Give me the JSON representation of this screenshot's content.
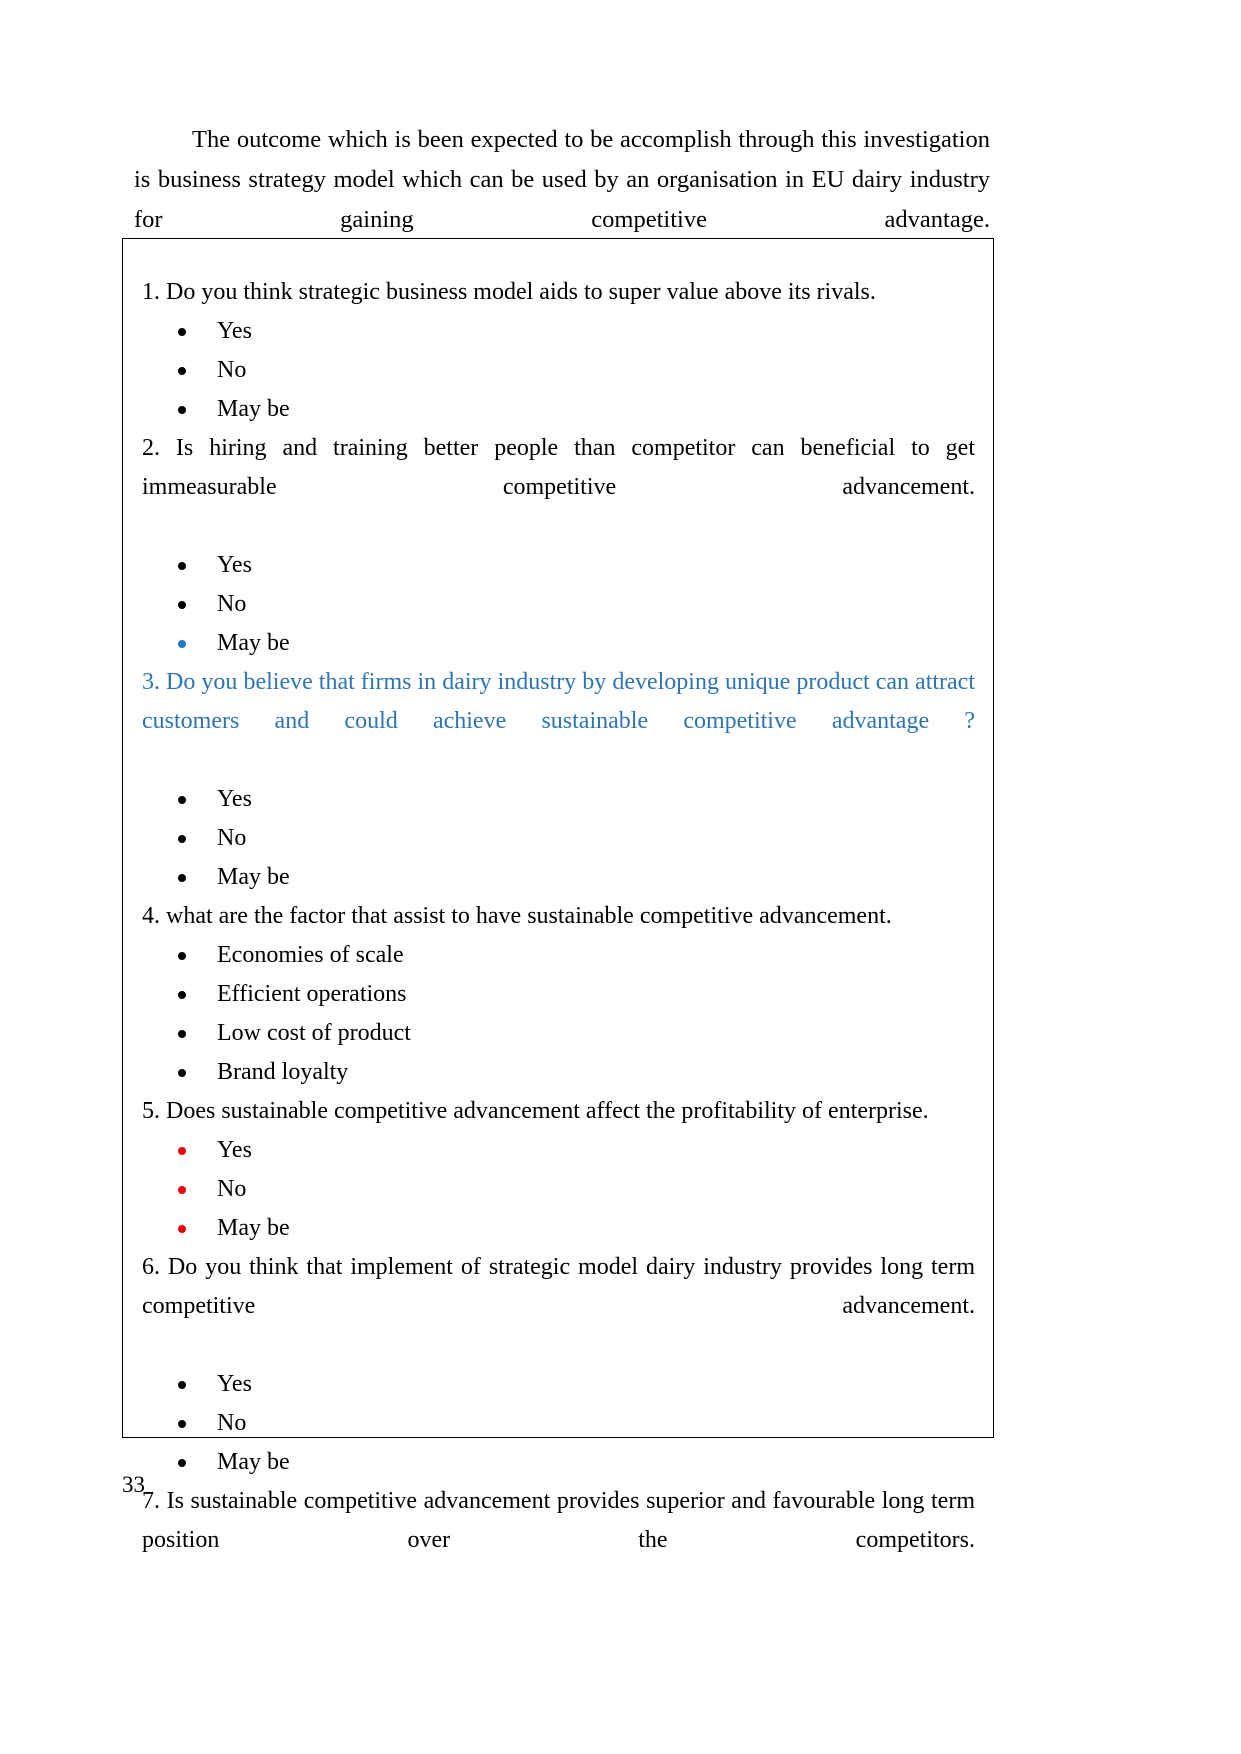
{
  "document": {
    "intro_paragraph": "The  outcome which is been expected  to be accomplish through this investigation is business strategy model which can be used by an organisation in EU dairy industry for gaining competitive advantage.",
    "page_number": "33"
  },
  "colors": {
    "text": "#000000",
    "blue_accent": "#2E74B5",
    "blue_bullet": "#1F7AC4",
    "red_bullet": "#E8000B",
    "border": "#000000"
  },
  "questionnaire": {
    "questions": [
      {
        "text": "1. Do you think strategic business model aids to super value above its rivals.",
        "color": "black",
        "justify": false,
        "options": [
          {
            "label": "Yes",
            "bullet_color": "black"
          },
          {
            "label": "No",
            "bullet_color": "black"
          },
          {
            "label": "May be",
            "bullet_color": "black"
          }
        ]
      },
      {
        "text": "2. Is hiring and training better people than competitor can beneficial to get immeasurable competitive advancement.",
        "color": "black",
        "justify": true,
        "options": [
          {
            "label": "Yes",
            "bullet_color": "black"
          },
          {
            "label": "No",
            "bullet_color": "black"
          },
          {
            "label": "May be",
            "bullet_color": "blue"
          }
        ]
      },
      {
        "text": "3. Do you believe that firms in dairy industry by developing unique product can attract customers  and could achieve sustainable competitive advantage ?",
        "color": "blue",
        "justify": true,
        "options": [
          {
            "label": "Yes",
            "bullet_color": "black"
          },
          {
            "label": "No",
            "bullet_color": "black"
          },
          {
            "label": "May be",
            "bullet_color": "black"
          }
        ]
      },
      {
        "text": "4. what are the factor that assist to have sustainable competitive advancement.",
        "color": "black",
        "justify": false,
        "options": [
          {
            "label": "Economies of scale",
            "bullet_color": "black"
          },
          {
            "label": "Efficient operations",
            "bullet_color": "black"
          },
          {
            "label": "Low cost of product",
            "bullet_color": "black"
          },
          {
            "label": "Brand loyalty",
            "bullet_color": "black"
          }
        ]
      },
      {
        "text": "5. Does sustainable competitive advancement affect the profitability of enterprise.",
        "color": "black",
        "justify": false,
        "options": [
          {
            "label": "Yes",
            "bullet_color": "red"
          },
          {
            "label": "No",
            "bullet_color": "red"
          },
          {
            "label": "May be",
            "bullet_color": "red"
          }
        ]
      },
      {
        "text": "6. Do you think that implement of strategic model dairy industry provides long term competitive advancement.",
        "color": "black",
        "justify": true,
        "options": [
          {
            "label": "Yes",
            "bullet_color": "black"
          },
          {
            "label": "No",
            "bullet_color": "black"
          },
          {
            "label": "May be",
            "bullet_color": "black"
          }
        ]
      },
      {
        "text": "7. Is sustainable competitive advancement provides superior and favourable long term position over the competitors.",
        "color": "black",
        "justify": true,
        "options": []
      }
    ]
  }
}
